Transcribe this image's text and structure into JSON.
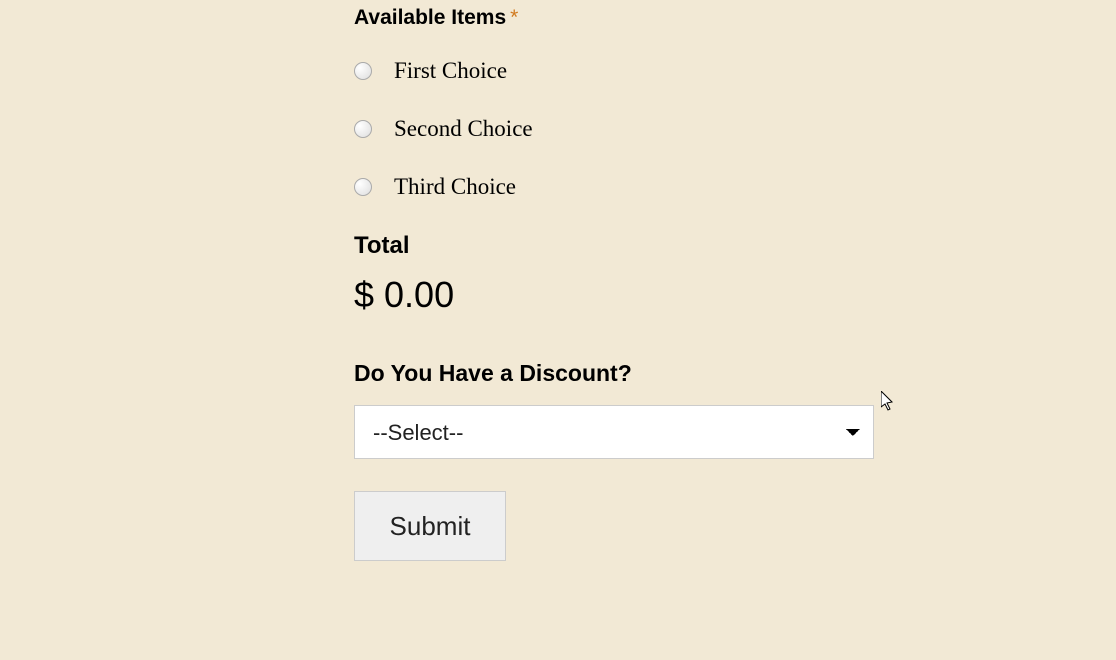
{
  "form": {
    "available_items": {
      "label": "Available Items",
      "required_mark": "*",
      "options": [
        "First Choice",
        "Second Choice",
        "Third Choice"
      ]
    },
    "total": {
      "label": "Total",
      "value": "$ 0.00"
    },
    "discount": {
      "label": "Do You Have a Discount?",
      "selected": "--Select--"
    },
    "submit_label": "Submit"
  }
}
